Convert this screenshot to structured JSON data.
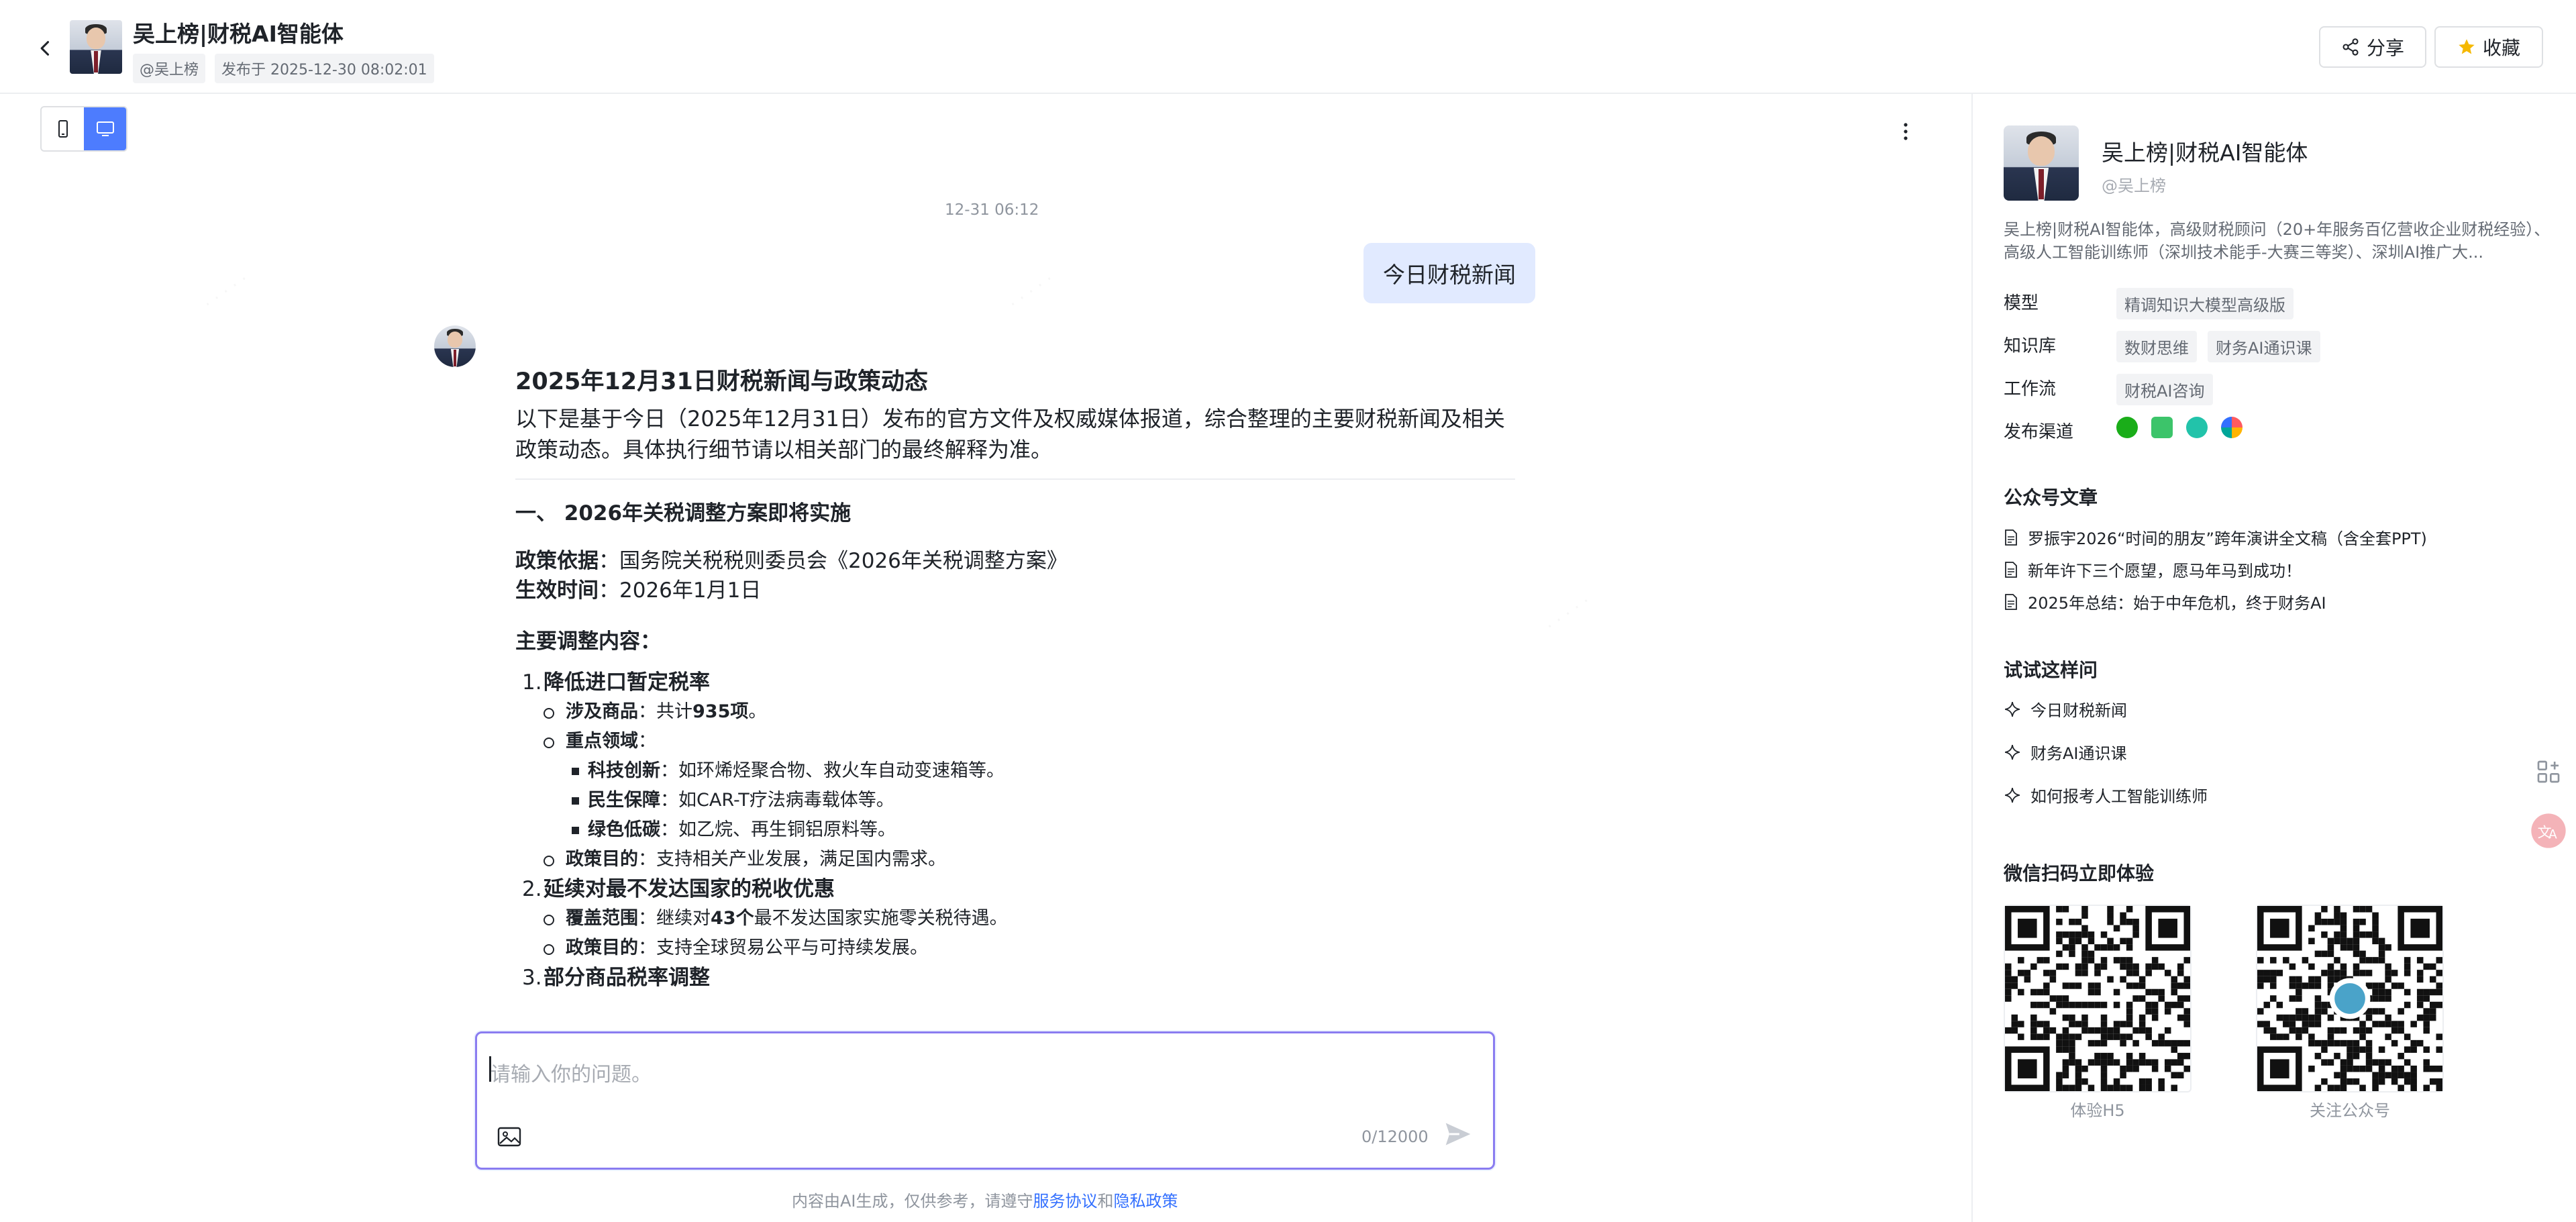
{
  "header": {
    "title": "吴上榜|财税AI智能体",
    "handle": "@吴上榜",
    "published": "发布于 2025-12-30 08:02:01",
    "share_label": "分享",
    "favorite_label": "收藏"
  },
  "chat": {
    "timestamp": "12-31 06:12",
    "user_message": "今日财税新闻",
    "title": "2025年12月31日财税新闻与政策动态",
    "intro": "以下是基于今日（2025年12月31日）发布的官方文件及权威媒体报道，综合整理的主要财税新闻及相关政策动态。具体执行细节请以相关部门的最终解释为准。",
    "section1_title": "一、 2026年关税调整方案即将实施",
    "basis_label": "政策依据",
    "basis_value": "：国务院关税税则委员会《2026年关税调整方案》",
    "effective_label": "生效时间",
    "effective_value": "：2026年1月1日",
    "main_content_label": "主要调整内容：",
    "item1": {
      "num": "1.",
      "title": "降低进口暂定税率",
      "goods_label": "涉及商品",
      "goods_pre": "：共计",
      "goods_count": "935项",
      "goods_post": "。",
      "focus_label": "重点领域",
      "focus_colon": "：",
      "tech_label": "科技创新",
      "tech_value": "：如环烯烃聚合物、救火车自动变速箱等。",
      "livelihood_label": "民生保障",
      "livelihood_value": "：如CAR-T疗法病毒载体等。",
      "green_label": "绿色低碳",
      "green_value": "：如乙烷、再生铜铝原料等。",
      "purpose_label": "政策目的",
      "purpose_value": "：支持相关产业发展，满足国内需求。"
    },
    "item2": {
      "num": "2.",
      "title": "延续对最不发达国家的税收优惠",
      "scope_label": "覆盖范围",
      "scope_pre": "：继续对",
      "scope_count": "43个",
      "scope_post": "最不发达国家实施零关税待遇。",
      "purpose_label": "政策目的",
      "purpose_value": "：支持全球贸易公平与可持续发展。"
    },
    "item3": {
      "num": "3.",
      "title": "部分商品税率调整"
    }
  },
  "input": {
    "placeholder": "请输入你的问题。",
    "counter": "0/12000"
  },
  "footer": {
    "note_pre": "内容由AI生成，仅供参考，请遵守",
    "terms_link": "服务协议",
    "and": "和",
    "privacy_link": "隐私政策"
  },
  "sidebar": {
    "name": "吴上榜|财税AI智能体",
    "handle": "@吴上榜",
    "description": "吴上榜|财税AI智能体，高级财税顾问（20+年服务百亿营收企业财税经验）、高级人工智能训练师（深圳技术能手-大赛三等奖）、深圳AI推广大...",
    "model_label": "模型",
    "model_tags": [
      "精调知识大模型高级版"
    ],
    "kb_label": "知识库",
    "kb_tags": [
      "数财思维",
      "财务AI通识课"
    ],
    "workflow_label": "工作流",
    "workflow_tags": [
      "财税AI咨询"
    ],
    "channel_label": "发布渠道",
    "articles_title": "公众号文章",
    "articles": [
      "罗振宇2026“时间的朋友”跨年演讲全文稿（含全套PPT)",
      "新年许下三个愿望，愿马年马到成功！",
      "2025年总结：始于中年危机，终于财务AI"
    ],
    "try_title": "试试这样问",
    "try_items": [
      "今日财税新闻",
      "财务AI通识课",
      "如何报考人工智能训练师"
    ],
    "qr_title": "微信扫码立即体验",
    "qr1_caption": "体验H5",
    "qr2_caption": "关注公众号"
  },
  "colors": {
    "accent": "#4d7cfe",
    "user_bubble": "#e1eaff",
    "input_border": "#8a7cf0",
    "link": "#3370ff",
    "tag_bg": "#f2f3f5"
  },
  "icons": {
    "back": "chevron-left-icon",
    "share": "share-icon",
    "favorite": "star-icon",
    "mobile": "mobile-icon",
    "desktop": "desktop-icon",
    "more": "more-vertical-icon",
    "image": "image-icon",
    "send": "send-icon",
    "article": "document-icon",
    "suggestion": "sparkle-icon"
  }
}
